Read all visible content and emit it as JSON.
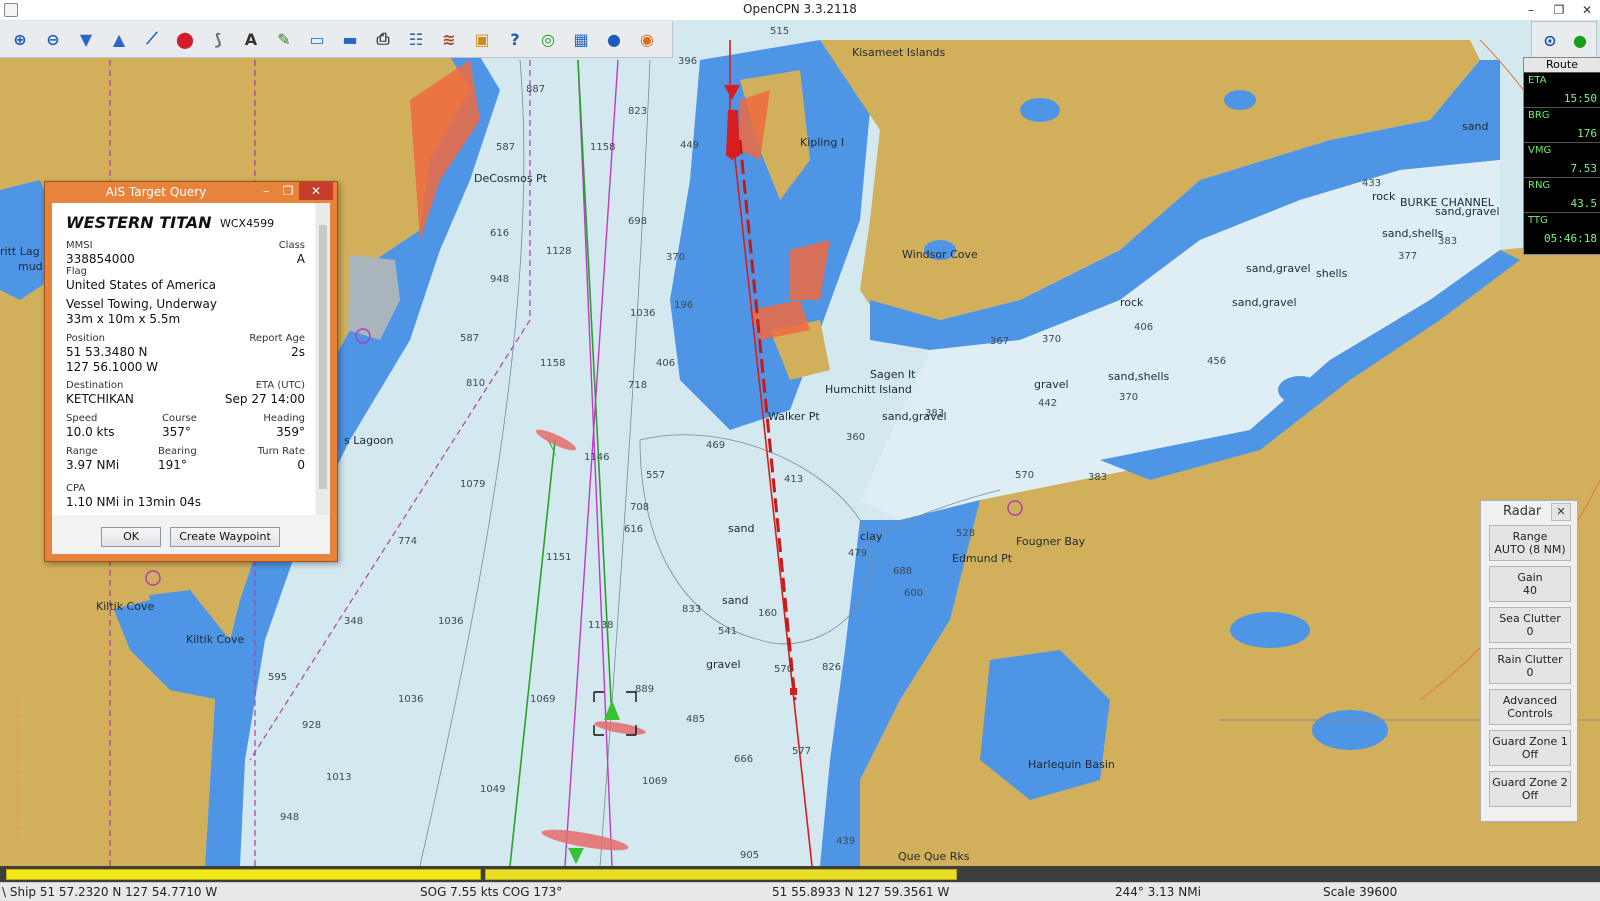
{
  "app": {
    "title": "OpenCPN 3.3.2118"
  },
  "window_controls": [
    "–",
    "❐",
    "✕"
  ],
  "toolbar": {
    "buttons": [
      {
        "name": "zoom-in",
        "glyph": "⊕"
      },
      {
        "name": "zoom-out",
        "glyph": "⊖"
      },
      {
        "name": "scale-in",
        "glyph": "▼"
      },
      {
        "name": "scale-out",
        "glyph": "▲"
      },
      {
        "name": "route",
        "glyph": "⟋"
      },
      {
        "name": "auto-follow",
        "glyph": "⬤"
      },
      {
        "name": "measure",
        "glyph": "⟆"
      },
      {
        "name": "text",
        "glyph": "A"
      },
      {
        "name": "chart-quilting",
        "glyph": "✎"
      },
      {
        "name": "settings",
        "glyph": "▭"
      },
      {
        "name": "tide",
        "glyph": "▬"
      },
      {
        "name": "print",
        "glyph": "⎙"
      },
      {
        "name": "route-manager",
        "glyph": "☷"
      },
      {
        "name": "track",
        "glyph": "≋"
      },
      {
        "name": "color-scheme",
        "glyph": "▣"
      },
      {
        "name": "help",
        "glyph": "?"
      },
      {
        "name": "radar",
        "glyph": "◎"
      },
      {
        "name": "plugin",
        "glyph": "▦"
      },
      {
        "name": "world",
        "glyph": "●"
      },
      {
        "name": "lifebuoy",
        "glyph": "◉"
      }
    ]
  },
  "dashboard": {
    "header": "Route",
    "items": [
      {
        "label": "ETA",
        "value": "15:50"
      },
      {
        "label": "BRG",
        "value": "176"
      },
      {
        "label": "VMG",
        "value": "7.53"
      },
      {
        "label": "RNG",
        "value": "43.5"
      },
      {
        "label": "TTG",
        "value": "05:46:18"
      }
    ]
  },
  "ais_dialog": {
    "title": "AIS Target Query",
    "vessel_name": "WESTERN TITAN",
    "callsign": "WCX4599",
    "mmsi_label": "MMSI",
    "mmsi": "338854000",
    "class_label": "Class",
    "class_value": "A",
    "flag_label": "Flag",
    "flag": "United States of America",
    "status": "Vessel Towing, Underway",
    "dimensions": "33m x 10m x 5.5m",
    "position_label": "Position",
    "report_age_label": "Report Age",
    "report_age": "2s",
    "lat": "51 53.3480 N",
    "lon": "127 56.1000 W",
    "destination_label": "Destination",
    "destination": "KETCHIKAN",
    "eta_label": "ETA (UTC)",
    "eta": "Sep 27 14:00",
    "speed_label": "Speed",
    "speed": "10.0 kts",
    "course_label": "Course",
    "course": "357°",
    "heading_label": "Heading",
    "heading": "359°",
    "range_label": "Range",
    "range": "3.97 NMi",
    "bearing_label": "Bearing",
    "bearing": "191°",
    "turn_rate_label": "Turn Rate",
    "turn_rate": "0",
    "cpa_label": "CPA",
    "cpa": "1.10 NMi in 13min 04s",
    "ok_label": "OK",
    "create_waypoint_label": "Create Waypoint"
  },
  "radar": {
    "title": "Radar",
    "buttons": [
      {
        "line1": "Range",
        "line2": "AUTO (8 NM)"
      },
      {
        "line1": "Gain",
        "line2": "40"
      },
      {
        "line1": "Sea Clutter",
        "line2": "0"
      },
      {
        "line1": "Rain Clutter",
        "line2": "0"
      },
      {
        "line1": "Advanced",
        "line2": "Controls"
      },
      {
        "line1": "Guard Zone 1",
        "line2": "Off"
      },
      {
        "line1": "Guard Zone 2",
        "line2": "Off"
      }
    ]
  },
  "map_labels": {
    "names": [
      "Kisameet Islands",
      "DeCosmos Pt",
      "Kipling I",
      "Windsor Cove",
      "Sagen It",
      "Humchitt Island",
      "Walker Pt",
      "Fougner Bay",
      "Edmund Pt",
      "Harlequin Basin",
      "Kiltik Cove",
      "Kiltik Cove",
      "s Lagoon",
      "Que Que Rks",
      "BURKE CHANNEL",
      "ritt Lag",
      "mud"
    ],
    "seabed": [
      "sand",
      "rock",
      "sand,gravel",
      "sand,shells",
      "sand,gravel",
      "shells",
      "sand,gravel",
      "rock",
      "gravel",
      "sand,shells",
      "sand,gravel",
      "clay",
      "sand",
      "sand",
      "gravel"
    ],
    "depths": [
      "515",
      "396",
      "823",
      "887",
      "1158",
      "587",
      "698",
      "449",
      "1128",
      "616",
      "370",
      "948",
      "1036",
      "196",
      "406",
      "1158",
      "718",
      "587",
      "810",
      "469",
      "557",
      "413",
      "1146",
      "708",
      "616",
      "1079",
      "774",
      "1151",
      "833",
      "541",
      "160",
      "570",
      "1036",
      "348",
      "1138",
      "889",
      "485",
      "1036",
      "1069",
      "826",
      "666",
      "1013",
      "1049",
      "1069",
      "577",
      "948",
      "905",
      "439",
      "433",
      "383",
      "377",
      "406",
      "370",
      "367",
      "442",
      "370",
      "456",
      "570",
      "383",
      "528",
      "688",
      "600",
      "479",
      "360",
      "383",
      "928",
      "595"
    ]
  },
  "status_bar": {
    "ship": "\\ Ship 51 57.2320 N   127 54.7710 W",
    "sog_cog": "SOG 7.55 kts  COG 173°",
    "cursor": "51 55.8933 N   127 59.3561 W",
    "brg_rng": "244°  3.13 NMi",
    "scale": "Scale 39600"
  }
}
